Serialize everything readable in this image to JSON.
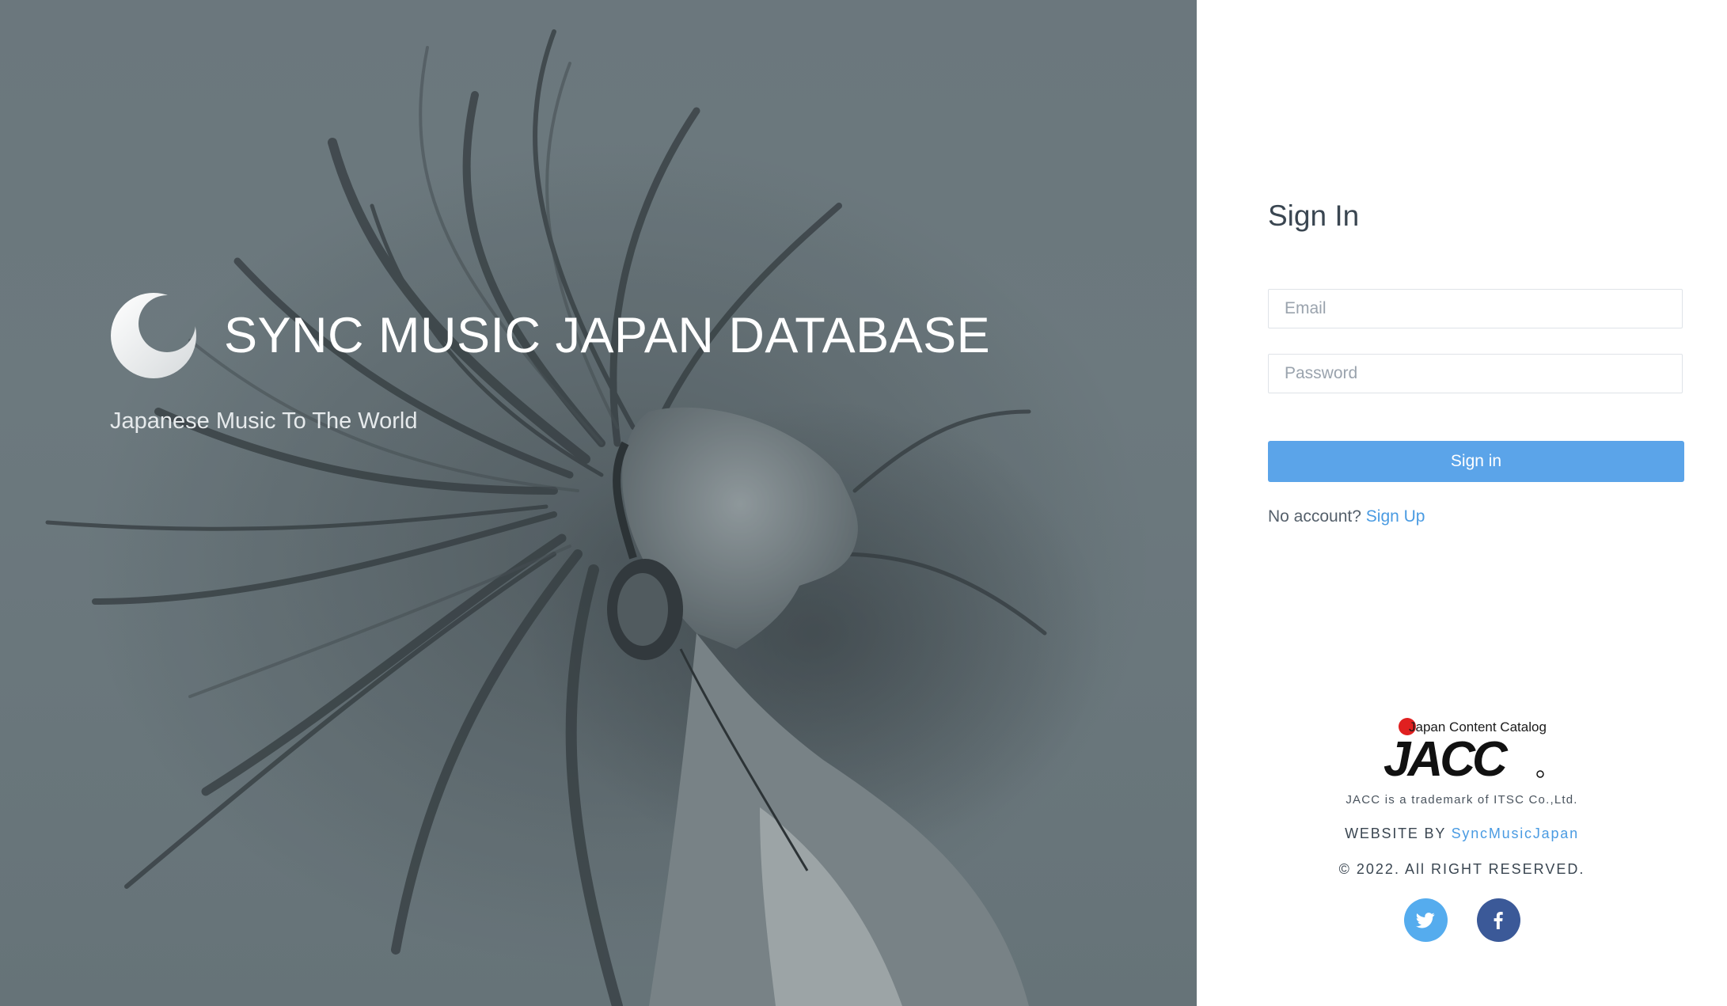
{
  "hero": {
    "brand_title": "SYNC MUSIC JAPAN DATABASE",
    "tagline": "Japanese Music To The World",
    "logo_icon": "crescent-moon-logo-icon"
  },
  "auth": {
    "title": "Sign In",
    "email_placeholder": "Email",
    "email_value": "",
    "password_placeholder": "Password",
    "password_value": "",
    "signin_label": "Sign in",
    "no_account_text": "No account?",
    "signup_link": "Sign Up"
  },
  "footer": {
    "jacc_logo_text": "Japan Content Catalog",
    "jacc_logo_mark": "JACC",
    "trademark": "JACC is a trademark of ITSC Co.,Ltd.",
    "website_by_prefix": "WEBSITE BY",
    "website_by_link": "SyncMusicJapan",
    "copyright": "© 2022. All RIGHT RESERVED.",
    "socials": [
      {
        "name": "twitter",
        "icon": "twitter-bird-icon",
        "color": "#55acee"
      },
      {
        "name": "facebook",
        "icon": "facebook-f-icon",
        "color": "#3b5998"
      }
    ]
  },
  "colors": {
    "accent": "#5ba4e9",
    "link": "#4a9be2",
    "heading": "#3a4651",
    "hero_bg": "#6f7b80"
  }
}
